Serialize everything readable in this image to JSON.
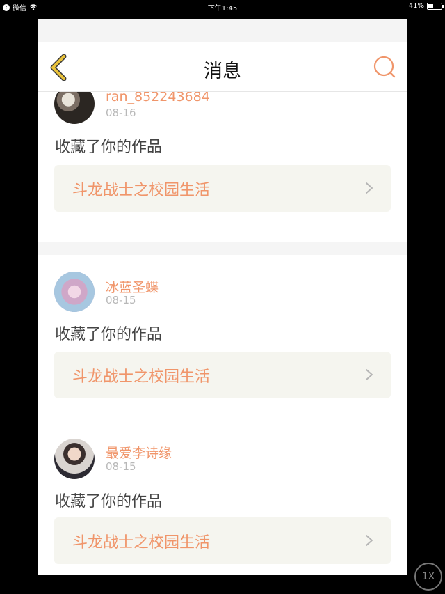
{
  "status_bar": {
    "back_app": "微信",
    "time": "下午1:45",
    "battery": "41%",
    "battery_level": 0.41
  },
  "header": {
    "title": "消息",
    "back_icon": "chevron-left-icon",
    "search_icon": "search-icon"
  },
  "messages": [
    {
      "username": "ran_852243684",
      "date": "08-16",
      "action": "收藏了你的作品",
      "work_title": "斗龙战士之校园生活"
    },
    {
      "username": "冰蓝圣蝶",
      "date": "08-15",
      "action": "收藏了你的作品",
      "work_title": "斗龙战士之校园生活"
    },
    {
      "username": "最爱李诗缘",
      "date": "08-15",
      "action": "收藏了你的作品",
      "work_title": "斗龙战士之校园生活"
    }
  ],
  "scale_button": "1X",
  "colors": {
    "accent": "#f0956a",
    "back_arrow": "#e9c23a",
    "search_icon": "#f0956a",
    "date_gray": "#b8b8b8",
    "link_bg": "#f5f5ef"
  }
}
